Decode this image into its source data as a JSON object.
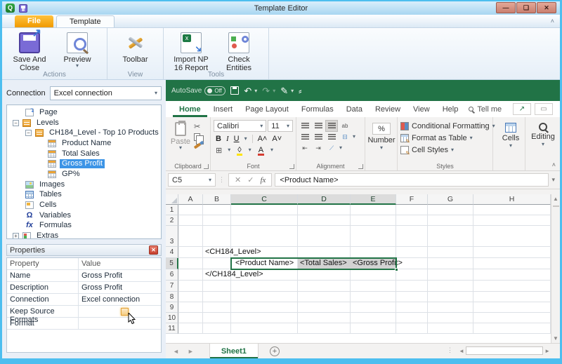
{
  "colors": {
    "excel_green": "#217346",
    "window_border": "#4dbeef",
    "file_tab_orange": "#f09a00",
    "selection_blue": "#3d94e6"
  },
  "window": {
    "title": "Template Editor",
    "minimize": "—",
    "maximize": "❑",
    "close": "✕"
  },
  "np": {
    "tabs": {
      "file": "File",
      "template": "Template"
    },
    "groups": {
      "actions": {
        "label": "Actions",
        "save_and_close": "Save And Close",
        "preview": "Preview"
      },
      "view": {
        "label": "View",
        "toolbar": "Toolbar"
      },
      "tools": {
        "label": "Tools",
        "import_report": "Import NP 16 Report",
        "check_entities": "Check Entities"
      }
    },
    "connection": {
      "label": "Connection",
      "value": "Excel connection"
    },
    "tree": {
      "items": [
        {
          "label": "Page"
        },
        {
          "label": "Levels"
        },
        {
          "label": "CH184_Level - Top 10 Products"
        },
        {
          "label": "Product Name"
        },
        {
          "label": "Total Sales"
        },
        {
          "label": "Gross Profit"
        },
        {
          "label": "GP%"
        },
        {
          "label": "Images"
        },
        {
          "label": "Tables"
        },
        {
          "label": "Cells"
        },
        {
          "label": "Variables"
        },
        {
          "label": "Formulas"
        },
        {
          "label": "Extras"
        }
      ]
    },
    "properties": {
      "title": "Properties",
      "col_property": "Property",
      "col_value": "Value",
      "rows": [
        {
          "property": "Name",
          "value": "Gross Profit"
        },
        {
          "property": "Description",
          "value": "Gross Profit"
        },
        {
          "property": "Connection",
          "value": "Excel connection"
        },
        {
          "property": "Keep Source Formats",
          "value": ""
        },
        {
          "property": "Format",
          "value": ""
        }
      ]
    }
  },
  "excel": {
    "autosave_label": "AutoSave",
    "autosave_state": "Off",
    "tabs": [
      "Home",
      "Insert",
      "Page Layout",
      "Formulas",
      "Data",
      "Review",
      "View",
      "Help"
    ],
    "active_tab": "Home",
    "tell_me": "Tell me",
    "ribbon": {
      "paste": "Paste",
      "clipboard_label": "Clipboard",
      "font_name": "Calibri",
      "font_size": "11",
      "bold": "B",
      "italic": "I",
      "underline": "U",
      "font_label": "Font",
      "alignment_label": "Alignment",
      "number_label": "Number",
      "percent": "%",
      "styles": {
        "conditional_formatting": "Conditional Formatting",
        "format_as_table": "Format as Table",
        "cell_styles": "Cell Styles",
        "label": "Styles"
      },
      "cells_label": "Cells",
      "editing_label": "Editing"
    },
    "formula_bar": {
      "name_box": "C5",
      "formula": "<Product Name>",
      "fx": "fx",
      "check": "✓",
      "cancel": "✕"
    },
    "grid": {
      "columns": [
        "A",
        "B",
        "C",
        "D",
        "E",
        "F",
        "G",
        "H"
      ],
      "rows": [
        "1",
        "2",
        "3",
        "4",
        "5",
        "6",
        "7",
        "8",
        "9",
        "10",
        "11"
      ],
      "selected_columns": [
        "C",
        "D",
        "E"
      ],
      "selected_row": "5",
      "active_cell": "C5",
      "cells": {
        "b4": "<CH184_Level>",
        "c5": "<Product Name>",
        "d5": "<Total Sales>",
        "e5": "<Gross Profit>",
        "b6": "</CH184_Level>"
      }
    },
    "sheet_tab": "Sheet1"
  },
  "glyphs": {
    "dropdown": "▾",
    "undo": "↶",
    "redo": "↷",
    "pen": "✎",
    "qat_more": "⸗",
    "collapse": "˄",
    "scissors": "✂",
    "share": "↗",
    "left": "◄",
    "right": "►",
    "up": "▲",
    "down": "▼",
    "add": "+",
    "dots_v": "⋮"
  }
}
